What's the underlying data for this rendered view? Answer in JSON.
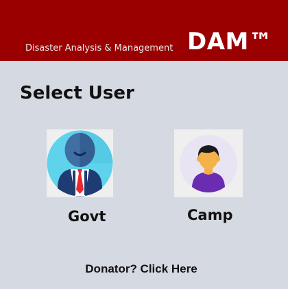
{
  "header": {
    "subtitle": "Disaster Analysis & Management",
    "brand": "DAM™",
    "background_color": "#9b0000"
  },
  "main": {
    "title": "Select User",
    "users": [
      {
        "label": "Govt",
        "icon": "government-official-avatar-icon"
      },
      {
        "label": "Camp",
        "icon": "camp-person-avatar-icon"
      }
    ],
    "donator_link": "Donator? Click Here"
  }
}
